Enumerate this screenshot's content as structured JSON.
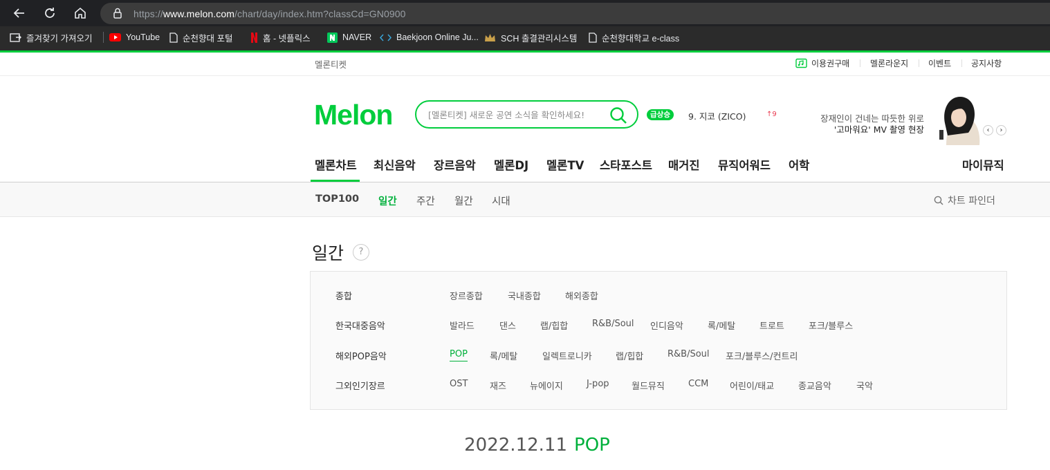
{
  "browser": {
    "url_prefix": "https://",
    "url_host": "www.melon.com",
    "url_path": "/chart/day/index.htm?classCd=GN0900",
    "bookmarks": [
      {
        "label": "즐겨찾기 가져오기",
        "icon": "bookmark-import-icon"
      },
      {
        "label": "YouTube",
        "icon": "youtube-icon"
      },
      {
        "label": "순천향대 포털",
        "icon": "page-icon"
      },
      {
        "label": "홈 - 넷플릭스",
        "icon": "netflix-icon"
      },
      {
        "label": "NAVER",
        "icon": "naver-icon"
      },
      {
        "label": "Baekjoon Online Ju...",
        "icon": "code-icon"
      },
      {
        "label": "SCH 출결관리시스템",
        "icon": "crown-icon"
      },
      {
        "label": "순천향대학교 e-class",
        "icon": "page-icon"
      }
    ]
  },
  "util": {
    "ticket": "멜론티켓",
    "links": [
      "이용권구매",
      "멜론라운지",
      "이벤트",
      "공지사항"
    ]
  },
  "header": {
    "logo": "Melon",
    "search_placeholder": "[멜론티켓] 새로운 공연 소식을 확인하세요!",
    "badge": "급상승",
    "rising": "9.  지코 (ZICO)",
    "rising_change": "↑9",
    "promo_line1": "장재인이 건네는 따듯한 위로",
    "promo_line2": "'고마워요' MV 촬영 현장"
  },
  "gnb": [
    "멜론차트",
    "최신음악",
    "장르음악",
    "멜론DJ",
    "멜론TV",
    "스타포스트",
    "매거진",
    "뮤직어워드",
    "어학"
  ],
  "mymusic": "마이뮤직",
  "subnav": {
    "items": [
      "TOP100",
      "일간",
      "주간",
      "월간",
      "시대"
    ],
    "chart_finder": "차트 파인더"
  },
  "page": {
    "title": "일간",
    "help": "?",
    "categories": [
      {
        "label": "종합",
        "items": [
          "장르종합",
          "국내종합",
          "해외종합"
        ]
      },
      {
        "label": "한국대중음악",
        "items": [
          "발라드",
          "댄스",
          "랩/힙합",
          "R&B/Soul",
          "인디음악",
          "록/메탈",
          "트로트",
          "포크/블루스"
        ]
      },
      {
        "label": "해외POP음악",
        "items": [
          "POP",
          "록/메탈",
          "일렉트로니카",
          "랩/힙합",
          "R&B/Soul",
          "포크/블루스/컨트리"
        ]
      },
      {
        "label": "그외인기장르",
        "items": [
          "OST",
          "재즈",
          "뉴에이지",
          "J-pop",
          "월드뮤직",
          "CCM",
          "어린이/태교",
          "종교음악",
          "국악"
        ]
      }
    ],
    "date": "2022.12.11",
    "genre": "POP"
  },
  "colors": {
    "accent": "#00cd3c",
    "active_text": "#00b03b",
    "chrome": "#202124"
  }
}
